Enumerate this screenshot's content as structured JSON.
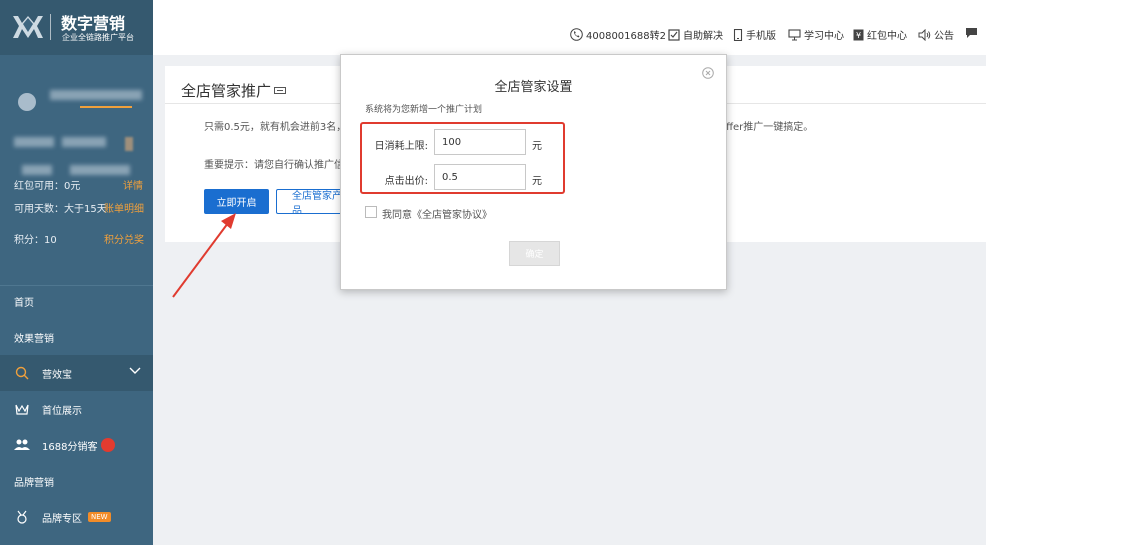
{
  "brand": {
    "title": "数字营销",
    "subtitle": "企业全链路推广平台"
  },
  "account": {
    "red_packet_label": "红包可用：0元",
    "red_packet_link": "详情",
    "days_label": "可用天数：大于15天",
    "bill_link": "账单明细",
    "points_label": "积分：10",
    "points_link": "积分兑奖"
  },
  "sidebar": {
    "items": [
      {
        "label": "首页"
      },
      {
        "label": "效果营销"
      },
      {
        "label": "营效宝",
        "icon": "search-icon"
      },
      {
        "label": "首位展示",
        "icon": "crown-icon"
      },
      {
        "label": "1688分销客",
        "icon": "users-icon"
      },
      {
        "label": "品牌营销"
      },
      {
        "label": "品牌专区",
        "icon": "brand-icon",
        "badge": "NEW"
      }
    ]
  },
  "topbar": {
    "phone": "4008001688转2",
    "items": [
      {
        "label": "自助解决",
        "icon": "checkbox-icon"
      },
      {
        "label": "手机版",
        "icon": "mobile-icon"
      },
      {
        "label": "学习中心",
        "icon": "monitor-icon"
      },
      {
        "label": "红包中心",
        "icon": "redpacket-icon"
      },
      {
        "label": "公告",
        "icon": "speaker-icon"
      },
      {
        "label": "",
        "icon": "chat-icon"
      }
    ]
  },
  "panel": {
    "title": "全店管家推广",
    "desc_left": "只需0.5元，就有机会进前3名，无",
    "desc_right": "offer推广一键搞定。",
    "notice": "重要提示：请您自行确认推广信息",
    "start_button": "立即开启",
    "outline_button": "全店管家产品"
  },
  "modal": {
    "title": "全店管家设置",
    "note": "系统将为您新增一个推广计划",
    "daily_limit_label": "日消耗上限:",
    "daily_limit_value": "100",
    "bid_label": "点击出价:",
    "bid_value": "0.5",
    "unit": "元",
    "agree_text": "我同意《全店管家协议》",
    "confirm_button": "确定"
  },
  "colors": {
    "sidebar": "#3e6680",
    "primary": "#1a6ed0",
    "highlight": "#e03b2f",
    "link_orange": "#f0a03c"
  }
}
